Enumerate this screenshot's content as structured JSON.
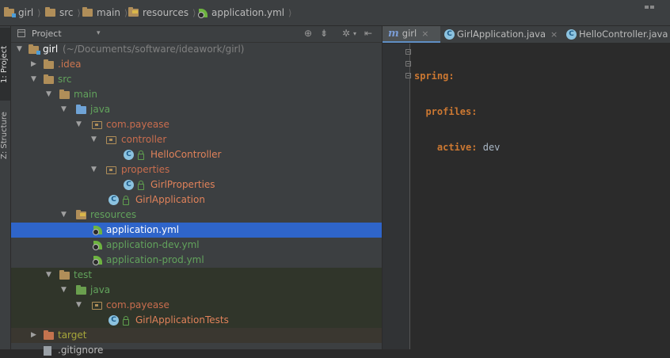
{
  "breadcrumb": [
    {
      "label": "girl",
      "icon": "module-folder-icon"
    },
    {
      "label": "src",
      "icon": "folder-icon"
    },
    {
      "label": "main",
      "icon": "folder-icon"
    },
    {
      "label": "resources",
      "icon": "resources-folder-icon"
    },
    {
      "label": "application.yml",
      "icon": "spring-yaml-icon"
    }
  ],
  "sidebar": {
    "tab_project": "1: Project",
    "tab_structure": "Z: Structure"
  },
  "project_panel": {
    "title": "Project",
    "view_selector_arrow": "▾",
    "header_icons": [
      "crosshair-icon",
      "collapse-all-icon",
      "gear-icon",
      "hide-icon"
    ],
    "tree": {
      "root_name": "girl",
      "root_path": "(~/Documents/software/ideawork/girl)",
      "idea": ".idea",
      "src": "src",
      "main": "main",
      "java": "java",
      "pkg": "com.payease",
      "controller": "controller",
      "hello": "HelloController",
      "properties": "properties",
      "girlprops": "GirlProperties",
      "girlapp": "GirlApplication",
      "resources": "resources",
      "appyml": "application.yml",
      "appdev": "application-dev.yml",
      "appprod": "application-prod.yml",
      "test": "test",
      "test_java": "java",
      "test_pkg": "com.payease",
      "girltests": "GirlApplicationTests",
      "target": "target",
      "gitignore": ".gitignore"
    }
  },
  "editor": {
    "tabs": [
      {
        "label": "girl",
        "icon": "maven-m-icon",
        "active": true
      },
      {
        "label": "GirlApplication.java",
        "icon": "spring-class-icon",
        "active": false
      },
      {
        "label": "HelloController.java",
        "icon": "class-icon",
        "active": false
      }
    ],
    "close_glyph": "×",
    "code": {
      "line1_key": "spring:",
      "line2_key": "profiles:",
      "line3_key": "active:",
      "line3_value": "dev"
    }
  },
  "colors": {
    "selection": "#2f65ca",
    "panel_bg": "#3c3f41",
    "editor_bg": "#2b2b2b",
    "yaml_key": "#cc7832",
    "tab_underline": "#5f8ec4"
  }
}
